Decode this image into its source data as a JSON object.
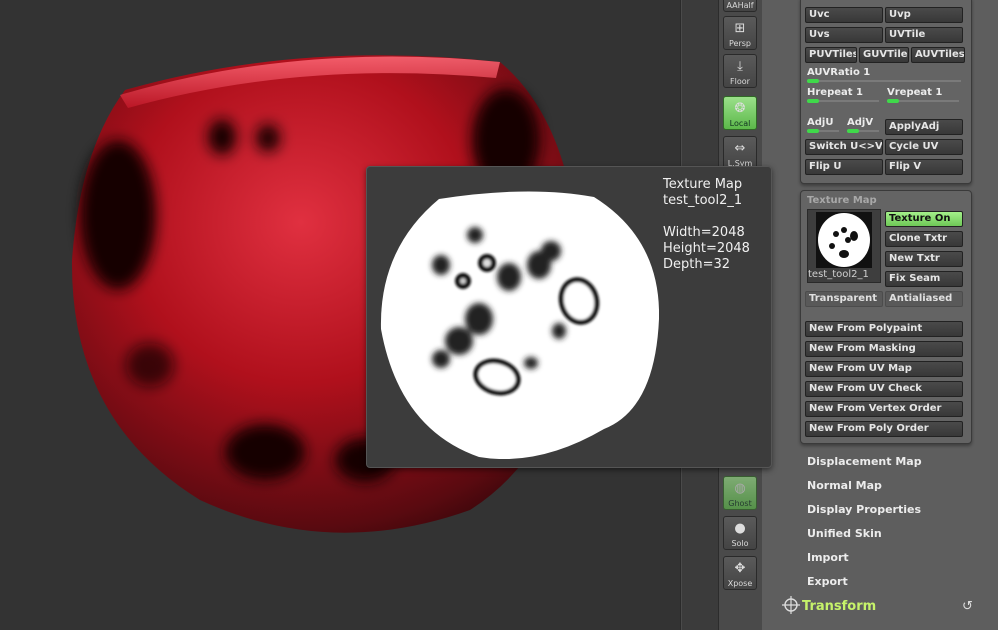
{
  "shelf": {
    "items": [
      {
        "label": "AAHalf",
        "icon": "aahalf-icon"
      },
      {
        "label": "Persp",
        "icon": "persp-icon"
      },
      {
        "label": "Floor",
        "icon": "floor-icon"
      },
      {
        "label": "Local",
        "icon": "local-icon",
        "active": true
      },
      {
        "label": "L.Sym",
        "icon": "lsym-icon"
      },
      {
        "label": "Ghost",
        "icon": "ghost-icon",
        "active": true
      },
      {
        "label": "Solo",
        "icon": "solo-icon"
      },
      {
        "label": "Xpose",
        "icon": "xpose-icon"
      }
    ]
  },
  "uv_panel": {
    "uvc": "Uvc",
    "uvp": "Uvp",
    "uvs": "Uvs",
    "uvtile": "UVTile",
    "puvtiles": "PUVTiles",
    "guvtiles": "GUVTiles",
    "auvtiles": "AUVTiles",
    "auvratio": "AUVRatio 1",
    "hrepeat": "Hrepeat 1",
    "vrepeat": "Vrepeat 1",
    "adju": "AdjU",
    "adjv": "AdjV",
    "applyadj": "ApplyAdj",
    "switch_uv": "Switch U<>V",
    "cycle_uv": "Cycle UV",
    "flip_u": "Flip U",
    "flip_v": "Flip V"
  },
  "texture_panel": {
    "title": "Texture Map",
    "texture_on": "Texture On",
    "clone_txtr": "Clone Txtr",
    "new_txtr": "New Txtr",
    "fix_seam": "Fix Seam",
    "thumb_caption": "test_tool2_1",
    "transparent": "Transparent",
    "antialiased": "Antialiased",
    "new_from": [
      "New From Polypaint",
      "New From Masking",
      "New From UV Map",
      "New From UV Check",
      "New From Vertex Order",
      "New From Poly Order"
    ]
  },
  "menu": {
    "items": [
      "Displacement Map",
      "Normal Map",
      "Display Properties",
      "Unified Skin",
      "Import",
      "Export"
    ],
    "transform": "Transform"
  },
  "tooltip": {
    "title": "Texture Map",
    "name": "test_tool2_1",
    "width": "Width=2048",
    "height": "Height=2048",
    "depth": "Depth=32"
  },
  "colors": {
    "accent_green": "#6ec857",
    "transform_text": "#c6f36a",
    "model_red": "#b0101c"
  }
}
